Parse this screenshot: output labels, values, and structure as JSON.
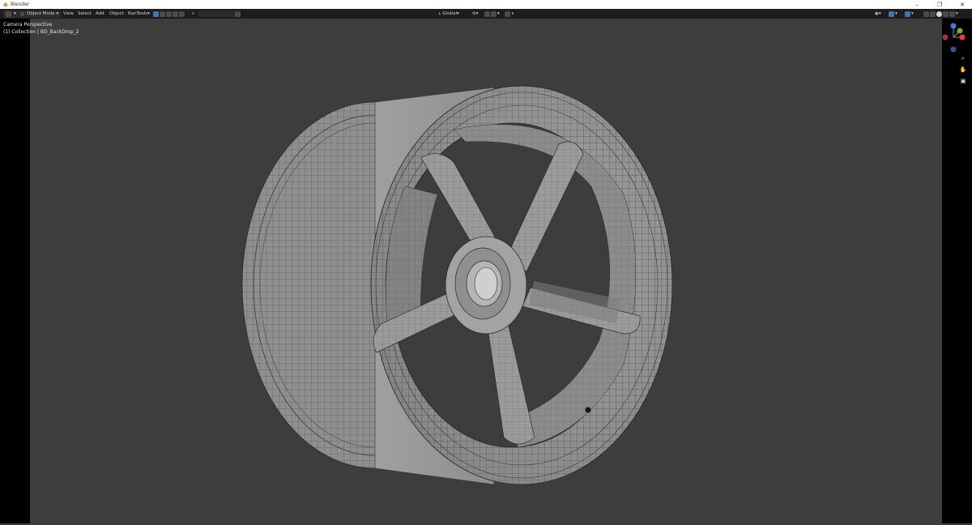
{
  "window": {
    "title": "Blender"
  },
  "header": {
    "mode": "Object Mode",
    "menus": [
      "View",
      "Select",
      "Add",
      "Object",
      "RanTools"
    ],
    "transform_orientation": "Global"
  },
  "viewport": {
    "camera_label": "Camera Perspective",
    "collection_label": "(1) Collection | BD_BackDrop_2"
  },
  "colors": {
    "background": "#3d3d3d",
    "header": "#1d1d1d",
    "accent": "#4772b3",
    "axis_x": "#e04050",
    "axis_y": "#7aa83c",
    "axis_z": "#4a7ad0"
  },
  "icons": {
    "nav": [
      "zoom-icon",
      "pan-hand-icon",
      "camera-view-icon"
    ]
  }
}
